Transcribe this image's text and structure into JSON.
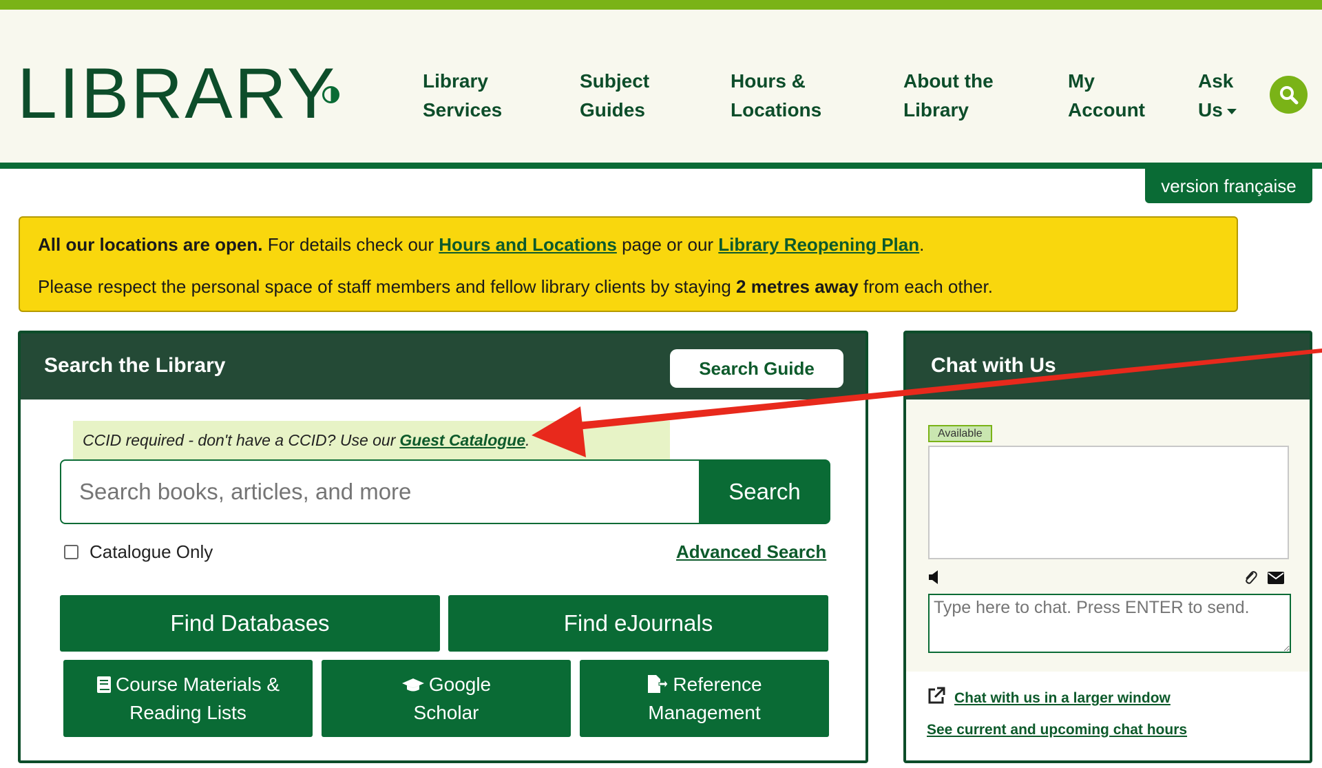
{
  "header": {
    "logo": "LIBRARY",
    "nav": [
      {
        "line1": "Library",
        "line2": "Services"
      },
      {
        "line1": "Subject",
        "line2": "Guides"
      },
      {
        "line1": "Hours &",
        "line2": "Locations"
      },
      {
        "line1": "About the",
        "line2": "Library"
      },
      {
        "line1": "My",
        "line2": "Account"
      },
      {
        "line1": "Ask",
        "line2": "Us"
      }
    ],
    "language_link": "version française",
    "icons": {
      "contrast": "contrast-toggle-icon",
      "search": "search-icon",
      "dropdown": "caret-down-icon"
    }
  },
  "alert": {
    "line1_bold": "All our locations are open.",
    "line1_text": " For details check our ",
    "link_hours": "Hours and Locations",
    "line1_mid": " page or our ",
    "link_reopening": "Library Reopening Plan",
    "line1_end": ".",
    "line2_start": "Please respect the personal space of staff members and fellow library clients by staying ",
    "line2_bold": "2 metres away",
    "line2_end": " from each other."
  },
  "search_panel": {
    "title": "Search the Library",
    "guide_button": "Search Guide",
    "ccid_text": "CCID required - don't have a CCID? Use our",
    "ccid_link": "Guest Catalogue",
    "ccid_end": ".",
    "input_placeholder": "Search books, articles, and more",
    "search_button": "Search",
    "catalogue_only_label": "Catalogue Only",
    "advanced_link": "Advanced Search",
    "find_databases": "Find Databases",
    "find_ejournals": "Find eJournals",
    "course_materials_line1": "Course Materials &",
    "course_materials_line2": "Reading Lists",
    "google_line1": "Google",
    "google_line2": "Scholar",
    "reference_line1": "Reference",
    "reference_line2": "Management"
  },
  "chat_panel": {
    "title": "Chat with Us",
    "status": "Available",
    "input_placeholder": "Type here to chat. Press ENTER to send.",
    "larger_window_link": "Chat with us in a larger window",
    "hours_link": "See current and upcoming chat hours"
  },
  "colors": {
    "brand_dark_green": "#0a6b35",
    "header_lime": "#7ab317",
    "alert_yellow": "#f9d70d",
    "annotation_red": "#e8291c"
  }
}
